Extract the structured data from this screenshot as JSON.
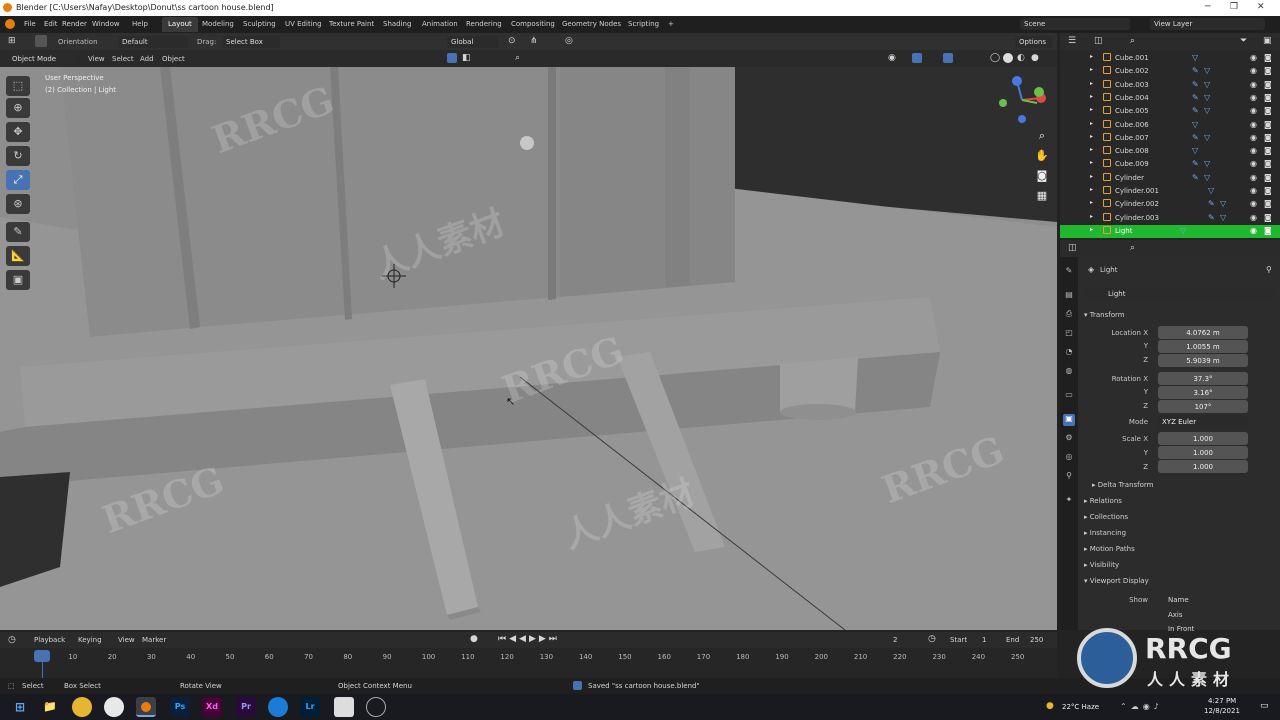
{
  "window": {
    "title": "Blender [C:\\Users\\Nafay\\Desktop\\Donut\\ss cartoon house.blend]"
  },
  "menus": [
    "File",
    "Edit",
    "Render",
    "Window",
    "Help"
  ],
  "workspaces": [
    "Layout",
    "Modeling",
    "Sculpting",
    "UV Editing",
    "Texture Paint",
    "Shading",
    "Animation",
    "Rendering",
    "Compositing",
    "Geometry Nodes",
    "Scripting"
  ],
  "active_workspace": "Layout",
  "add_tab": "+",
  "scene": {
    "label": "Scene",
    "view_layer": "View Layer"
  },
  "header1": {
    "orientation": "Orientation",
    "orientation_value": "Default",
    "drag": "Drag:",
    "drag_value": "Select Box",
    "transform": "Global",
    "options": "Options"
  },
  "header2": {
    "mode": "Object Mode",
    "menus": [
      "View",
      "Select",
      "Add",
      "Object"
    ]
  },
  "viewport": {
    "info_line1": "User Perspective",
    "info_line2": "(2) Collection | Light",
    "accent": "#4772b3"
  },
  "outliner": {
    "rows": [
      {
        "name": "Cube.001",
        "mods": 1
      },
      {
        "name": "Cube.002",
        "mods": 2
      },
      {
        "name": "Cube.003",
        "mods": 2
      },
      {
        "name": "Cube.004",
        "mods": 2
      },
      {
        "name": "Cube.005",
        "mods": 2
      },
      {
        "name": "Cube.006",
        "mods": 1
      },
      {
        "name": "Cube.007",
        "mods": 2
      },
      {
        "name": "Cube.008",
        "mods": 1
      },
      {
        "name": "Cube.009",
        "mods": 2
      },
      {
        "name": "Cylinder",
        "mods": 2
      },
      {
        "name": "Cylinder.001",
        "mods": 1
      },
      {
        "name": "Cylinder.002",
        "mods": 2
      },
      {
        "name": "Cylinder.003",
        "mods": 2
      },
      {
        "name": "Light",
        "mods": 1,
        "selected": true
      }
    ],
    "selected_color": "#1fb82e"
  },
  "properties": {
    "object_name": "Light",
    "data_name": "Light",
    "transform_title": "Transform",
    "location": {
      "label": "Location X",
      "x": "4.0762 m",
      "y": "1.0055 m",
      "z": "5.9039 m"
    },
    "rotation": {
      "label": "Rotation X",
      "x": "37.3°",
      "y": "3.16°",
      "z": "107°"
    },
    "mode": {
      "label": "Mode",
      "value": "XYZ Euler"
    },
    "scale": {
      "label": "Scale X",
      "x": "1.000",
      "y": "1.000",
      "z": "1.000"
    },
    "axis_y": "Y",
    "axis_z": "Z",
    "delta": "Delta Transform",
    "sections": [
      "Relations",
      "Collections",
      "Instancing",
      "Motion Paths",
      "Visibility"
    ],
    "viewport_display": "Viewport Display",
    "show_label": "Show",
    "show_items": [
      "Name",
      "Axis",
      "In Front"
    ]
  },
  "timeline": {
    "menus": [
      "Playback",
      "Keying",
      "View",
      "Marker"
    ],
    "current_frame": "2",
    "start_label": "Start",
    "start": "1",
    "end_label": "End",
    "end": "250",
    "ruler": [
      "2",
      "10",
      "20",
      "30",
      "40",
      "50",
      "60",
      "70",
      "80",
      "90",
      "100",
      "110",
      "120",
      "130",
      "140",
      "150",
      "160",
      "170",
      "180",
      "190",
      "200",
      "210",
      "220",
      "230",
      "240",
      "250"
    ]
  },
  "status": {
    "select": "Select",
    "box_select": "Box Select",
    "rotate_view": "Rotate View",
    "context_menu": "Object Context Menu",
    "message": "Saved \"ss cartoon house.blend\""
  },
  "taskbar": {
    "apps": [
      "Ps",
      "Xd",
      "Pr",
      "Lr"
    ],
    "weather": "22°C Haze",
    "time": "4:27 PM",
    "date": "12/8/2021"
  },
  "watermarks": {
    "brand": "RRCG",
    "cn": "人人素材"
  }
}
